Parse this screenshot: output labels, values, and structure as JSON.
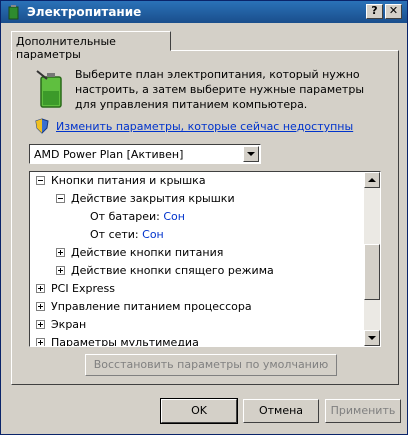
{
  "window": {
    "title": "Электропитание",
    "help_label": "?",
    "close_label": "✕"
  },
  "tab": {
    "label": "Дополнительные параметры"
  },
  "description": "Выберите план электропитания, который нужно настроить, а затем выберите нужные параметры для управления питанием компьютера.",
  "link": {
    "label": "Изменить параметры, которые сейчас недоступны"
  },
  "plan_select": {
    "value": "AMD Power Plan [Активен]"
  },
  "tree": {
    "items": [
      {
        "label": "Кнопки питания и крышка",
        "state": "expanded"
      },
      {
        "label": "Действие закрытия крышки",
        "state": "expanded"
      },
      {
        "label": "От батареи:",
        "value": "Сон"
      },
      {
        "label": "От сети:",
        "value": "Сон"
      },
      {
        "label": "Действие кнопки питания",
        "state": "collapsed"
      },
      {
        "label": "Действие кнопки спящего режима",
        "state": "collapsed"
      },
      {
        "label": "PCI Express",
        "state": "collapsed"
      },
      {
        "label": "Управление питанием процессора",
        "state": "collapsed"
      },
      {
        "label": "Экран",
        "state": "collapsed"
      },
      {
        "label": "Параметры мультимедиа",
        "state": "collapsed"
      }
    ]
  },
  "restore_button": {
    "label": "Восстановить параметры по умолчанию"
  },
  "buttons": {
    "ok": "OK",
    "cancel": "Отмена",
    "apply": "Применить"
  },
  "colors": {
    "titlebar": "#1a4e8c",
    "link": "#0033cc",
    "face": "#d4d0c8"
  },
  "icons": {
    "battery": "battery-plug-icon",
    "shield": "uac-shield-icon"
  }
}
